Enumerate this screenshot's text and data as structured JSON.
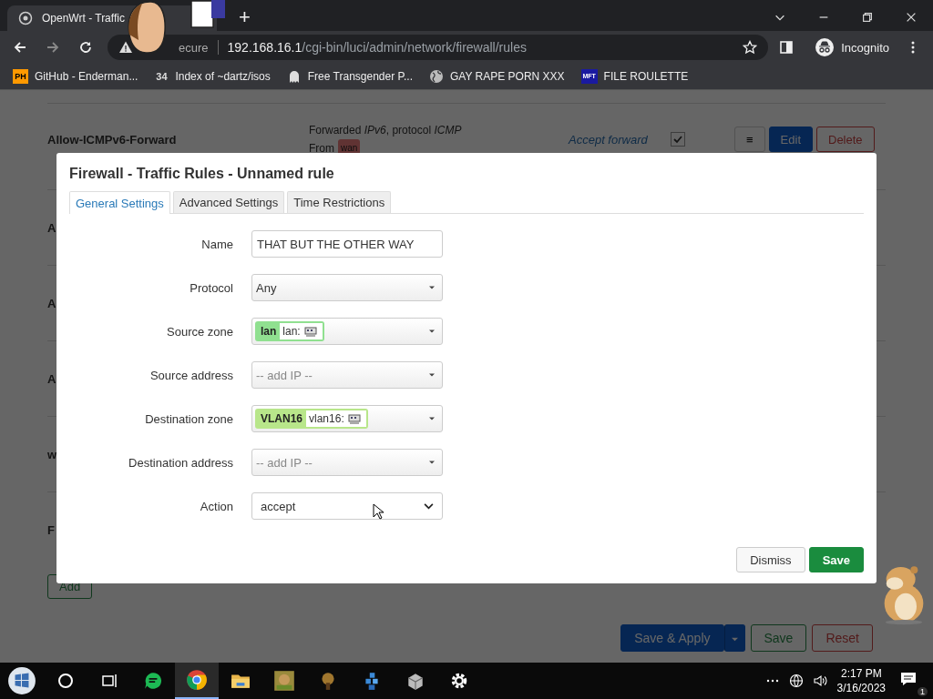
{
  "browser": {
    "tab_title": "OpenWrt - Traffic",
    "new_tab": "+",
    "address_warning": "ecure",
    "url_host": "192.168.16.1",
    "url_path": "/cgi-bin/luci/admin/network/firewall/rules",
    "profile": "Incognito"
  },
  "bookmarks": [
    {
      "kind": "ph",
      "badge": "PH",
      "label": "GitHub - Enderman..."
    },
    {
      "kind": "digits",
      "badge": "34",
      "label": "Index of ~dartz/isos"
    },
    {
      "kind": "ghost",
      "label": "Free Transgender P..."
    },
    {
      "kind": "globe",
      "label": "GAY RAPE PORN XXX"
    },
    {
      "kind": "mft",
      "badge": "MFT",
      "label": "FILE ROULETTE"
    }
  ],
  "page": {
    "rule": {
      "name": "Allow-ICMPv6-Forward",
      "match": "Forwarded *IPv6*, protocol *ICMP*",
      "from_label": "From",
      "from_zone": "wan",
      "action": "Accept forward",
      "enabled": true,
      "buttons": [
        "≡",
        "Edit",
        "Delete"
      ]
    },
    "other_rows": [
      "A",
      "A",
      "A",
      "w",
      "F"
    ],
    "add_button": "Add",
    "footer_buttons": [
      {
        "kind": "apply",
        "label": "Save & Apply"
      },
      {
        "kind": "save",
        "label": "Save"
      },
      {
        "kind": "reset",
        "label": "Reset"
      }
    ]
  },
  "dialog": {
    "title": "Firewall - Traffic Rules - Unnamed rule",
    "tabs": [
      {
        "label": "General Settings",
        "selected": true
      },
      {
        "label": "Advanced Settings",
        "selected": false
      },
      {
        "label": "Time Restrictions",
        "selected": false
      }
    ],
    "fields": [
      {
        "label": "Name",
        "kind": "text",
        "value": "THAT BUT THE OTHER WAY"
      },
      {
        "label": "Protocol",
        "kind": "dropdown",
        "value": "Any"
      },
      {
        "label": "Source zone",
        "kind": "zone",
        "zone": "lan",
        "color": "#90e090",
        "device": "lan:"
      },
      {
        "label": "Source address",
        "kind": "dropdown",
        "placeholder": "-- add IP --"
      },
      {
        "label": "Destination zone",
        "kind": "zone",
        "zone": "VLAN16",
        "color": "#b8e68a",
        "device": "vlan16:"
      },
      {
        "label": "Destination address",
        "kind": "dropdown",
        "placeholder": "-- add IP --"
      },
      {
        "label": "Action",
        "kind": "select",
        "value": "accept"
      }
    ],
    "buttons": [
      {
        "kind": "dismiss",
        "label": "Dismiss"
      },
      {
        "kind": "save",
        "label": "Save"
      }
    ]
  },
  "taskbar": {
    "apps": [
      {
        "kind": "cortana",
        "selected": false
      },
      {
        "kind": "taskview",
        "selected": false
      },
      {
        "kind": "chat",
        "selected": false
      },
      {
        "kind": "chrome",
        "selected": true
      },
      {
        "kind": "folder",
        "selected": false
      },
      {
        "kind": "game",
        "selected": false
      },
      {
        "kind": "tool",
        "selected": false
      },
      {
        "kind": "cubes",
        "selected": false
      },
      {
        "kind": "box",
        "selected": false
      },
      {
        "kind": "gear",
        "selected": false
      }
    ],
    "time": "2:17 PM",
    "date": "3/16/2023",
    "notifications": "1"
  }
}
